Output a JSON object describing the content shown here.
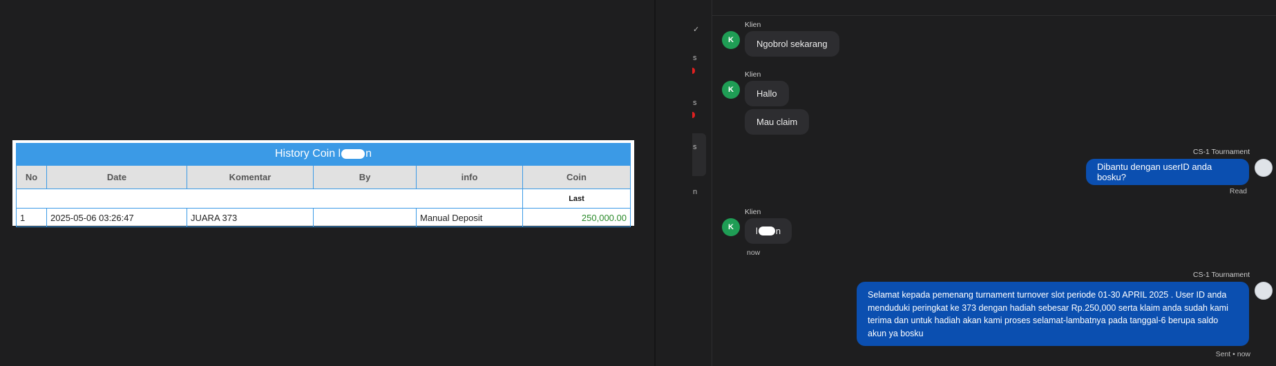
{
  "history_table": {
    "title_prefix": "History Coin l",
    "title_suffix": "n",
    "columns": [
      "No",
      "Date",
      "Komentar",
      "By",
      "info",
      "Coin"
    ],
    "sub_header": "Last",
    "rows": [
      {
        "no": "1",
        "date": "2025-05-06 03:26:47",
        "komentar": "JUARA 373",
        "by": "",
        "info": "Manual Deposit",
        "coin": "250,000.00"
      }
    ]
  },
  "sidebar_fragments": [
    "s",
    "s",
    "s",
    "n"
  ],
  "chat": {
    "client_label": "Klien",
    "client_initial": "K",
    "agent_label": "CS-1 Tournament",
    "messages": {
      "m1": "Ngobrol sekarang",
      "m2": "Hallo",
      "m3": "Mau claim",
      "m4": "Dibantu dengan userID anda bosku?",
      "m4_status": "Read",
      "m5_prefix": "l",
      "m5_suffix": "n",
      "m5_time": "now",
      "m6": "Selamat kepada pemenang turnament turnover slot periode 01-30 APRIL 2025 . User ID anda menduduki peringkat ke 373 dengan hadiah sebesar Rp.250,000 serta klaim anda sudah kami terima dan untuk hadiah akan kami proses selamat-lambatnya pada tanggal-6 berupa saldo akun ya bosku",
      "m6_status": "Sent • now"
    }
  },
  "colors": {
    "table_header": "#3b9ae6",
    "coin_green": "#2a8a2a",
    "client_avatar": "#1f9d55",
    "agent_bubble": "#0b4fb0",
    "client_bubble": "#2d2d30"
  }
}
